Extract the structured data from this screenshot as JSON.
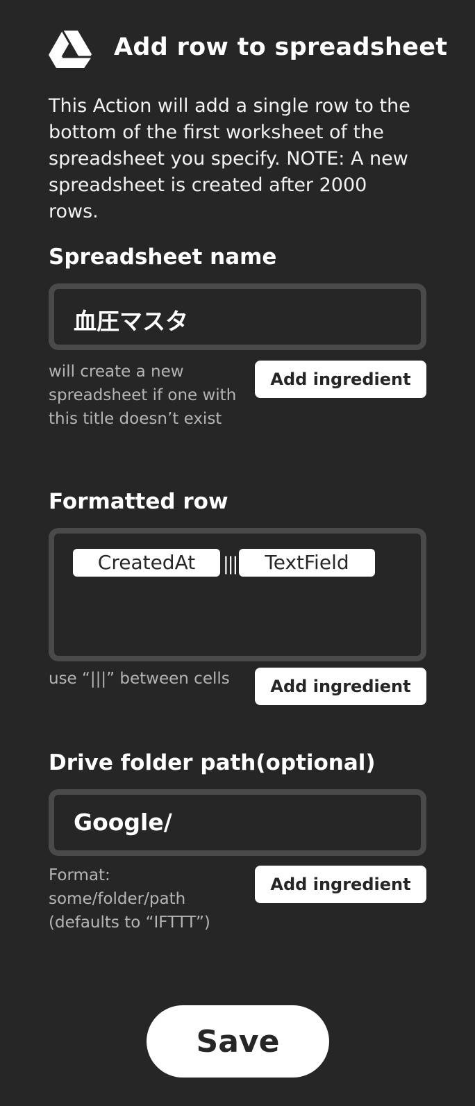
{
  "header": {
    "title": "Add row to spreadsheet",
    "logo_icon": "google-drive-icon"
  },
  "description": "This Action will add a single row to the bottom of the first worksheet of the spreadsheet you specify. NOTE: A new spreadsheet is created after 2000 rows.",
  "spreadsheet_name": {
    "label": "Spreadsheet name",
    "value": "血圧マスタ",
    "help": "will create a new spreadsheet if one with this title doesn’t exist",
    "button": "Add ingredient"
  },
  "formatted_row": {
    "label": "Formatted row",
    "ingredients": [
      "CreatedAt",
      "TextField"
    ],
    "separator": "|||",
    "help": "use “|||” between cells",
    "button": "Add ingredient"
  },
  "drive_folder": {
    "label": "Drive folder path(optional)",
    "value": "Google/",
    "help": "Format: some/folder/path (defaults to “IFTTT”)",
    "button": "Add ingredient"
  },
  "save_label": "Save",
  "colors": {
    "background": "#262626",
    "field_border": "#4a4a4a",
    "button_bg": "#ffffff",
    "help_text": "#b5b5b5"
  }
}
